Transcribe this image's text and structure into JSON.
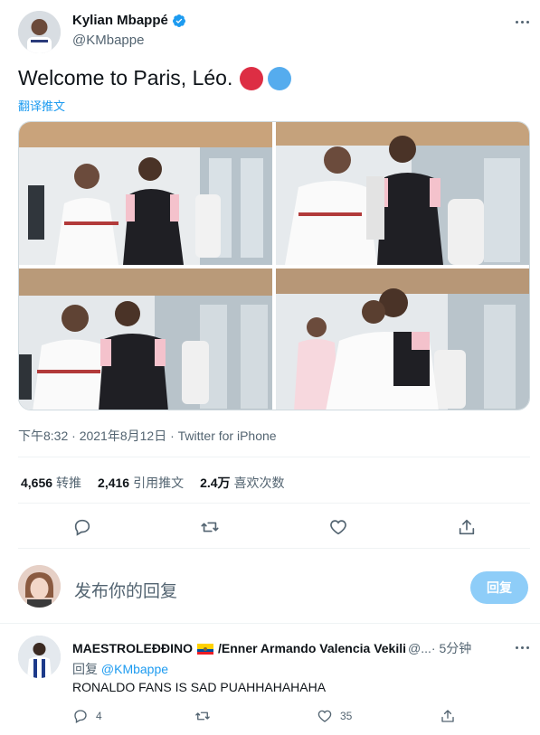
{
  "tweet": {
    "author_name": "Kylian Mbappé",
    "author_handle": "@KMbappe",
    "text": "Welcome to Paris, Léo.",
    "emojis": [
      "red-circle-emoji",
      "blue-circle-emoji"
    ],
    "translate_label": "翻译推文",
    "timestamp": "下午8:32 · 2021年8月12日 · Twitter for iPhone",
    "photos": [
      {
        "name": "photo-1"
      },
      {
        "name": "photo-2"
      },
      {
        "name": "photo-3"
      },
      {
        "name": "photo-4"
      }
    ]
  },
  "stats": [
    {
      "value": "4,656",
      "label": "转推"
    },
    {
      "value": "2,416",
      "label": "引用推文"
    },
    {
      "value": "2.4万",
      "label": "喜欢次数"
    }
  ],
  "actions": {
    "icons": [
      "reply-icon",
      "retweet-icon",
      "like-icon",
      "share-icon"
    ]
  },
  "compose": {
    "placeholder": "发布你的回复",
    "button_label": "回复"
  },
  "reply": {
    "name": "MAESTROLEĐĐINO",
    "flag": "ecuador-flag",
    "name_suffix": "/Enner Armando Valencia Vekili",
    "handle": "@...",
    "time": "· 5分钟",
    "replying_prefix": "回复 ",
    "replying_to": "@KMbappe",
    "text": "RONALDO FANS IS SAD PUAHHAHAHAHA",
    "reply_count": "4",
    "like_count": "35"
  },
  "colors": {
    "accent": "#1d9bf0",
    "reply_button": "#8ecdf8",
    "muted_text": "#536471"
  }
}
